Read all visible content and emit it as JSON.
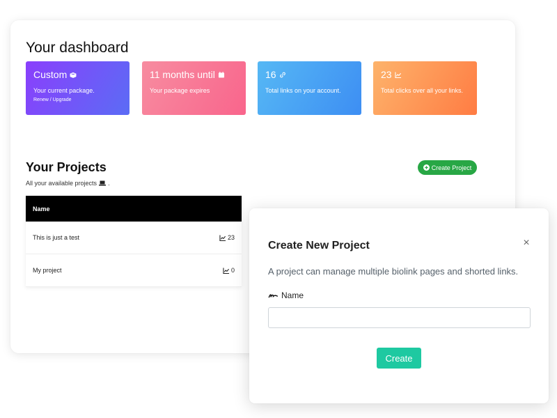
{
  "dashboard": {
    "title": "Your dashboard",
    "stats": [
      {
        "big": "Custom",
        "sub": "Your current package.",
        "link": "Renew / Upgrade",
        "icon": "box-icon"
      },
      {
        "big": "11 months until",
        "sub": "Your package expires",
        "icon": "calendar-icon"
      },
      {
        "big": "16",
        "sub": "Total links on your account.",
        "icon": "link-icon"
      },
      {
        "big": "23",
        "sub": "Total clicks over all your links.",
        "icon": "chart-icon"
      }
    ]
  },
  "projects": {
    "title": "Your Projects",
    "subtitle": "All your available projects",
    "subtitle_suffix": ".",
    "create_label": "Create Project",
    "table": {
      "header": "Name",
      "rows": [
        {
          "name": "This is just a test",
          "count": "23"
        },
        {
          "name": "My project",
          "count": "0"
        }
      ]
    }
  },
  "modal": {
    "title": "Create New Project",
    "close": "×",
    "description": "A project can manage multiple biolink pages and shorted links.",
    "name_label": "Name",
    "name_value": "",
    "create_label": "Create"
  }
}
